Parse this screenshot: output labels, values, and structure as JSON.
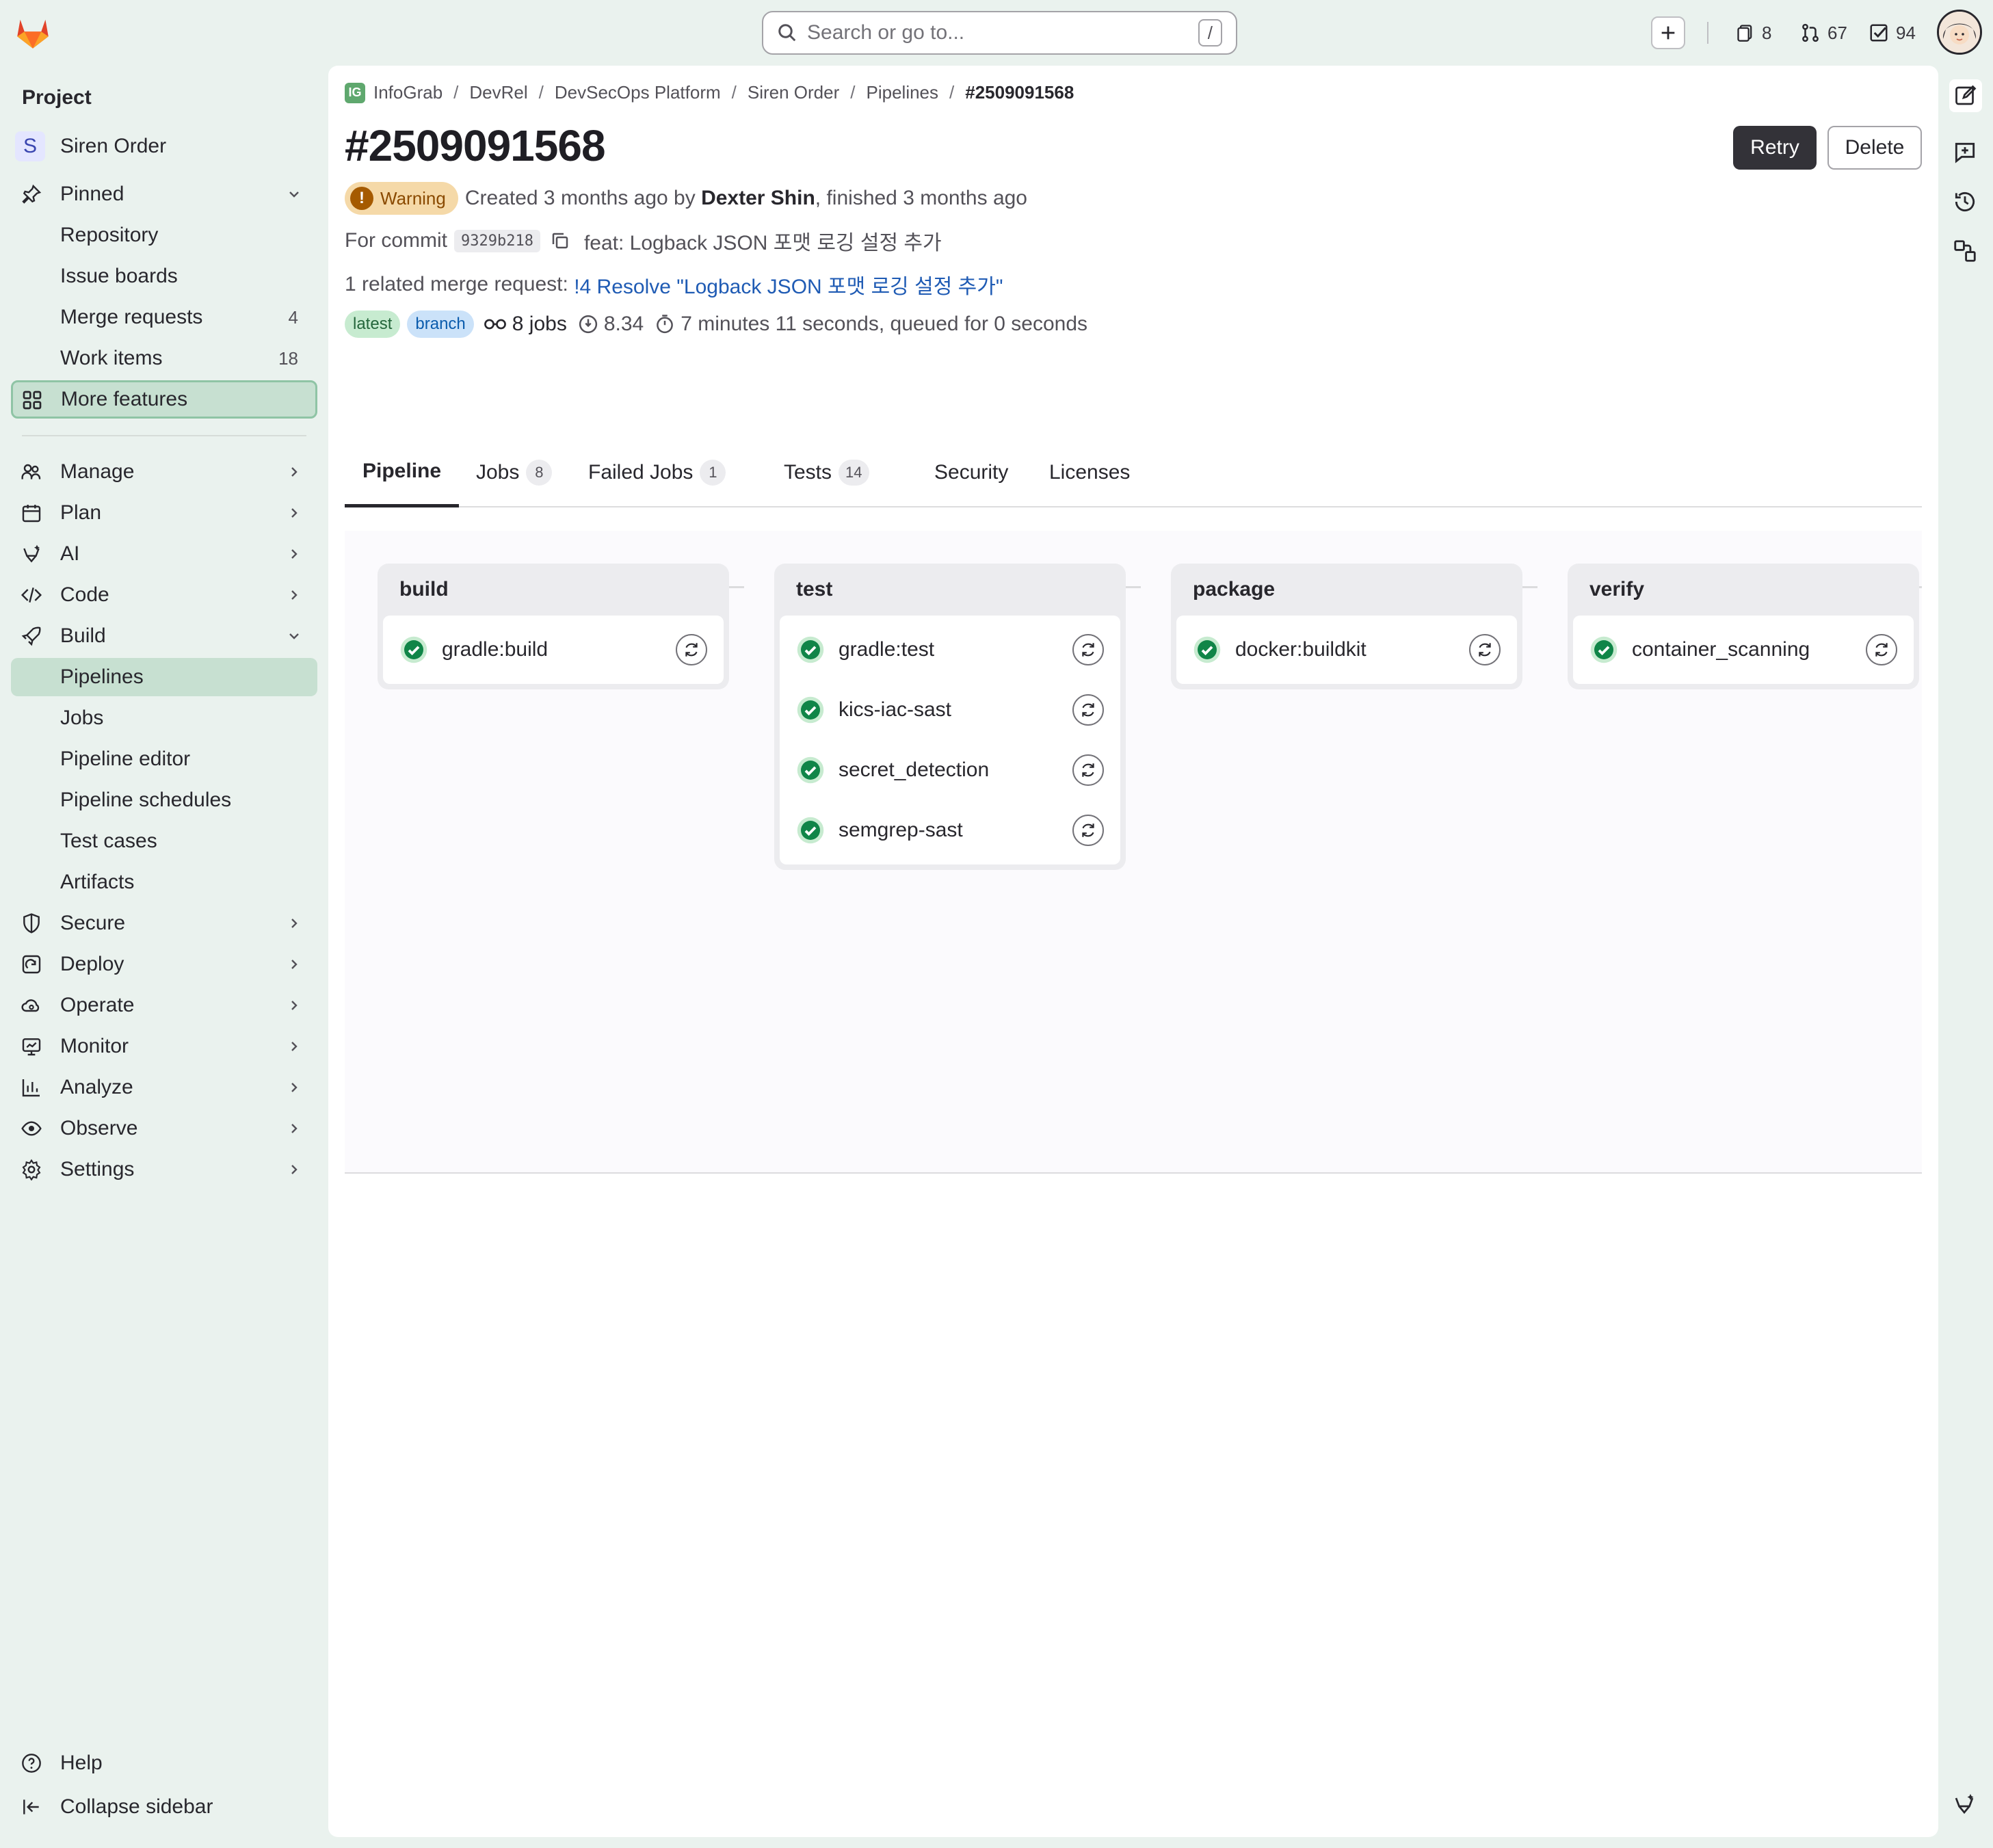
{
  "topbar": {
    "search_placeholder": "Search or go to...",
    "search_shortcut": "/",
    "issues_count": "8",
    "merge_requests_count": "67",
    "todos_count": "94"
  },
  "sidebar": {
    "section_title": "Project",
    "project_initial": "S",
    "project_name": "Siren Order",
    "pinned": "Pinned",
    "pinned_items": [
      {
        "label": "Repository",
        "count": ""
      },
      {
        "label": "Issue boards",
        "count": ""
      },
      {
        "label": "Merge requests",
        "count": "4"
      },
      {
        "label": "Work items",
        "count": "18"
      }
    ],
    "more_features": "More features",
    "manage": "Manage",
    "plan": "Plan",
    "ai": "AI",
    "code": "Code",
    "build": "Build",
    "build_items": [
      "Pipelines",
      "Jobs",
      "Pipeline editor",
      "Pipeline schedules",
      "Test cases",
      "Artifacts"
    ],
    "secure": "Secure",
    "deploy": "Deploy",
    "operate": "Operate",
    "monitor": "Monitor",
    "analyze": "Analyze",
    "observe": "Observe",
    "settings": "Settings",
    "help": "Help",
    "collapse": "Collapse sidebar"
  },
  "breadcrumb": {
    "ig_initials": "IG",
    "items": [
      "InfoGrab",
      "DevRel",
      "DevSecOps Platform",
      "Siren Order",
      "Pipelines"
    ],
    "current": "#2509091568",
    "sep": "/"
  },
  "pipeline": {
    "title": "#2509091568",
    "retry": "Retry",
    "delete": "Delete",
    "status": "Warning",
    "created_prefix": "Created 3 months ago by",
    "author": "Dexter Shin",
    "finished": ", finished 3 months ago",
    "commit_prefix": "For commit",
    "commit_sha": "9329b218",
    "commit_message": "feat: Logback JSON 포맷 로깅 설정 추가",
    "mr_prefix": "1 related merge request:",
    "mr_link": "!4 Resolve \"Logback JSON 포맷 로깅 설정 추가\"",
    "badge_latest": "latest",
    "badge_branch": "branch",
    "jobs_count": "8 jobs",
    "compute": "8.34",
    "duration": "7 minutes 11 seconds, queued for 0 seconds"
  },
  "tabs": {
    "pipeline": "Pipeline",
    "jobs": "Jobs",
    "jobs_count": "8",
    "failed": "Failed Jobs",
    "failed_count": "1",
    "tests": "Tests",
    "tests_count": "14",
    "security": "Security",
    "licenses": "Licenses"
  },
  "stages": [
    {
      "name": "build",
      "jobs": [
        "gradle:build"
      ]
    },
    {
      "name": "test",
      "jobs": [
        "gradle:test",
        "kics-iac-sast",
        "secret_detection",
        "semgrep-sast"
      ]
    },
    {
      "name": "package",
      "jobs": [
        "docker:buildkit"
      ]
    },
    {
      "name": "verify",
      "jobs": [
        "container_scanning"
      ]
    }
  ],
  "colors": {
    "success": "#108548",
    "warning_bg": "#f5d9a8",
    "active_nav": "#c7e0d1",
    "link": "#1f5bb4"
  }
}
